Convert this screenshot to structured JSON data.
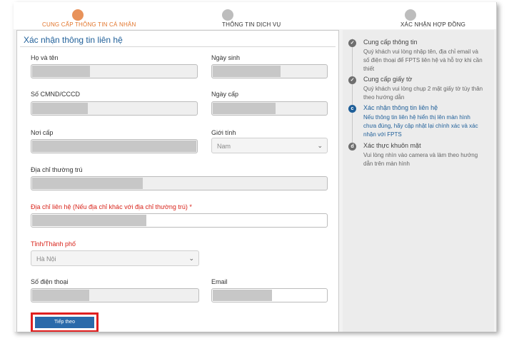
{
  "stepper": {
    "steps": [
      {
        "label": "CUNG CẤP THÔNG TIN CÁ NHÂN",
        "color": "#e2752b"
      },
      {
        "label": "THÔNG TIN DỊCH VỤ",
        "color": "#333333"
      },
      {
        "label": "XÁC NHẬN HỢP ĐỒNG",
        "color": "#333333"
      }
    ]
  },
  "form": {
    "title": "Xác nhận thông tin liên hệ",
    "full_name_label": "Họ và tên",
    "dob_label": "Ngày sinh",
    "id_label": "Số CMND/CCCD",
    "issue_date_label": "Ngày cấp",
    "issue_place_label": "Nơi cấp",
    "gender_label": "Giới tính",
    "gender_value": "Nam",
    "perm_address_label": "Địa chỉ thường trú",
    "contact_address_label": "Địa chỉ liên hệ (Nếu địa chỉ khác với địa chỉ thường trú) *",
    "province_label": "Tỉnh/Thành phố",
    "province_value": "Hà Nội",
    "phone_label": "Số điện thoại",
    "email_label": "Email",
    "submit_label": "Tiếp theo"
  },
  "sidebar": {
    "items": [
      {
        "icon": "check-icon",
        "title": "Cung cấp thông tin",
        "desc": "Quý khách vui lòng nhập tên, địa chỉ email và số điện thoại để FPTS liên hệ và hỗ trợ khi cần thiết"
      },
      {
        "icon": "check-icon",
        "title": "Cung cấp giấy tờ",
        "desc": "Quý khách vui lòng chụp 2 mặt giấy tờ tùy thân theo hướng dẫn"
      },
      {
        "icon": "c",
        "title": "Xác nhận thông tin liên hệ",
        "desc": "Nếu thông tin liên hệ hiển thị lên màn hình chưa đúng, hãy cập nhật lại chính xác và xác nhận với FPTS"
      },
      {
        "icon": "d",
        "title": "Xác thực khuôn mặt",
        "desc": "Vui lòng nhìn vào camera và làm theo hướng dẫn trên màn hình"
      }
    ]
  }
}
